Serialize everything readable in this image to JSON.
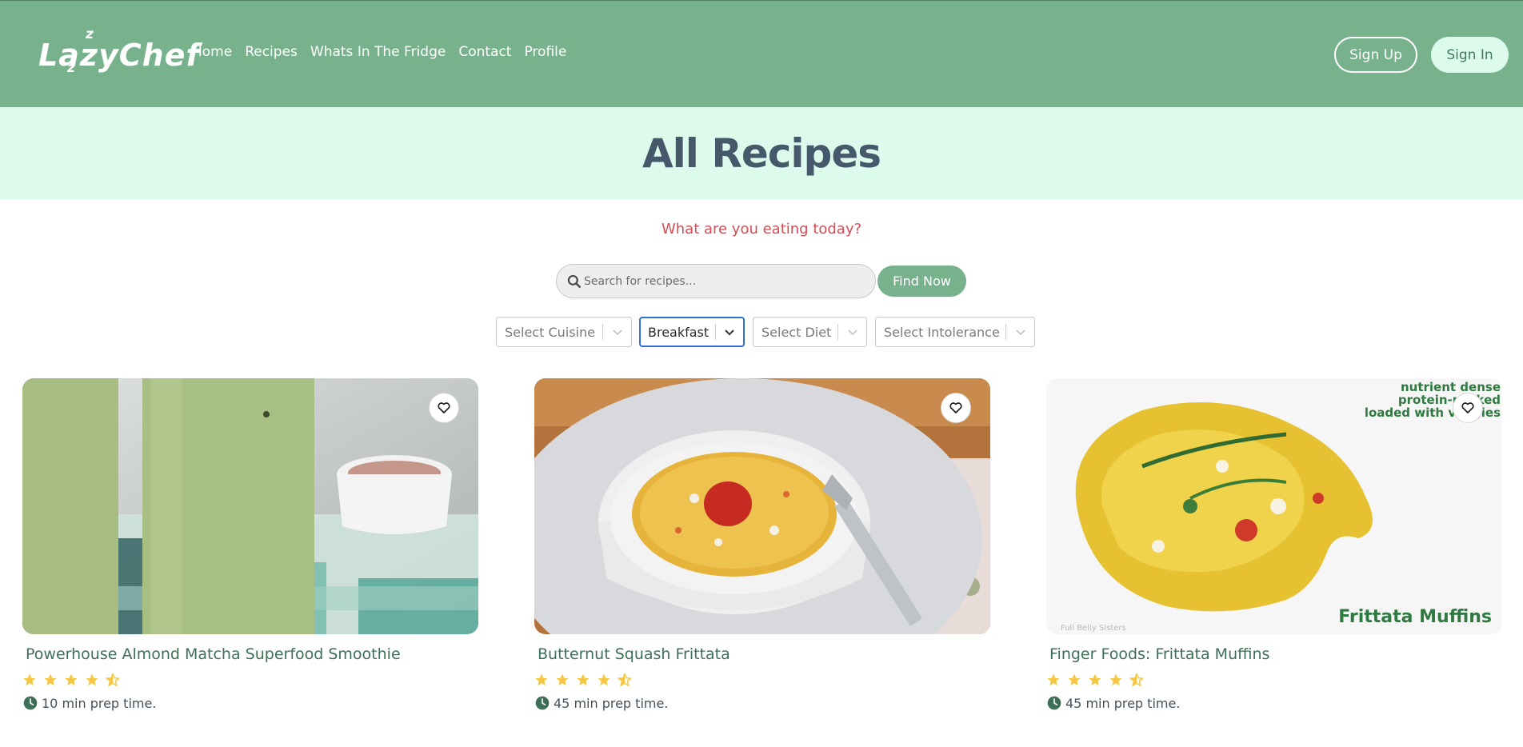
{
  "brand": {
    "logo_text": "LazyChef",
    "logo_z1": "z",
    "logo_z2": "z"
  },
  "nav": {
    "items": [
      {
        "label": "Home"
      },
      {
        "label": "Recipes"
      },
      {
        "label": "Whats In The Fridge"
      },
      {
        "label": "Contact"
      },
      {
        "label": "Profile"
      }
    ],
    "sign_up_label": "Sign Up",
    "sign_in_label": "Sign In"
  },
  "hero": {
    "title": "All Recipes"
  },
  "search": {
    "subtitle": "What are you eating today?",
    "placeholder": "Search for recipes...",
    "value": "",
    "button_label": "Find Now"
  },
  "filters": [
    {
      "name": "cuisine",
      "value": "Select Cuisine",
      "active": false
    },
    {
      "name": "meal-type",
      "value": "Breakfast",
      "active": true
    },
    {
      "name": "diet",
      "value": "Select Diet",
      "active": false
    },
    {
      "name": "intolerance",
      "value": "Select Intolerance",
      "active": false
    }
  ],
  "recipes": [
    {
      "title": "Powerhouse Almond Matcha Superfood Smoothie",
      "rating": 4.5,
      "prep": "10 min prep time.",
      "favorited": false
    },
    {
      "title": "Butternut Squash Frittata",
      "rating": 4.5,
      "prep": "45 min prep time.",
      "favorited": false
    },
    {
      "title": "Finger Foods: Frittata Muffins",
      "rating": 4.5,
      "prep": "45 min prep time.",
      "favorited": false,
      "image_text": {
        "top_line1": "nutrient dense",
        "top_line2": "protein-packed",
        "top_line3": "loaded with veggies",
        "bottom": "Frittata Muffins",
        "credit": "Full Belly Sisters"
      }
    }
  ],
  "colors": {
    "navbar": "#77b28d",
    "hero_bg": "#dcfbec",
    "title": "#46596b",
    "subtitle": "#d24d55",
    "accent": "#77b28d",
    "star": "#f6c744",
    "focus": "#2f6fd6"
  },
  "icons": {
    "search": "search-icon",
    "chevron": "chevron-down-icon",
    "heart": "heart-icon",
    "star": "star-icon",
    "clock": "clock-icon"
  }
}
